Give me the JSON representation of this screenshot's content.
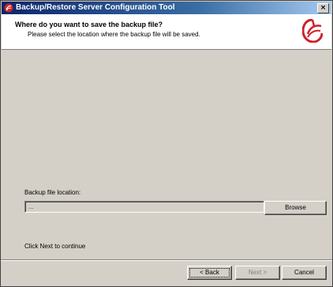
{
  "window": {
    "title": "Backup/Restore Server Configuration Tool",
    "close_glyph": "×"
  },
  "header": {
    "title": "Where do you want to save the backup file?",
    "subtitle": "Please select the location where the backup file will be saved."
  },
  "form": {
    "location_label": "Backup file location:",
    "location_value": "...",
    "browse_label": "Browse"
  },
  "hint": "Click Next to continue",
  "buttons": {
    "back": "< Back",
    "next": "Next >",
    "cancel": "Cancel"
  },
  "icons": {
    "title": "app-logo-icon",
    "header": "app-logo-icon",
    "close": "close-icon"
  },
  "colors": {
    "brand_red": "#d0202a",
    "title_bar": "#0a246a",
    "dialog_face": "#d4d0c8"
  }
}
